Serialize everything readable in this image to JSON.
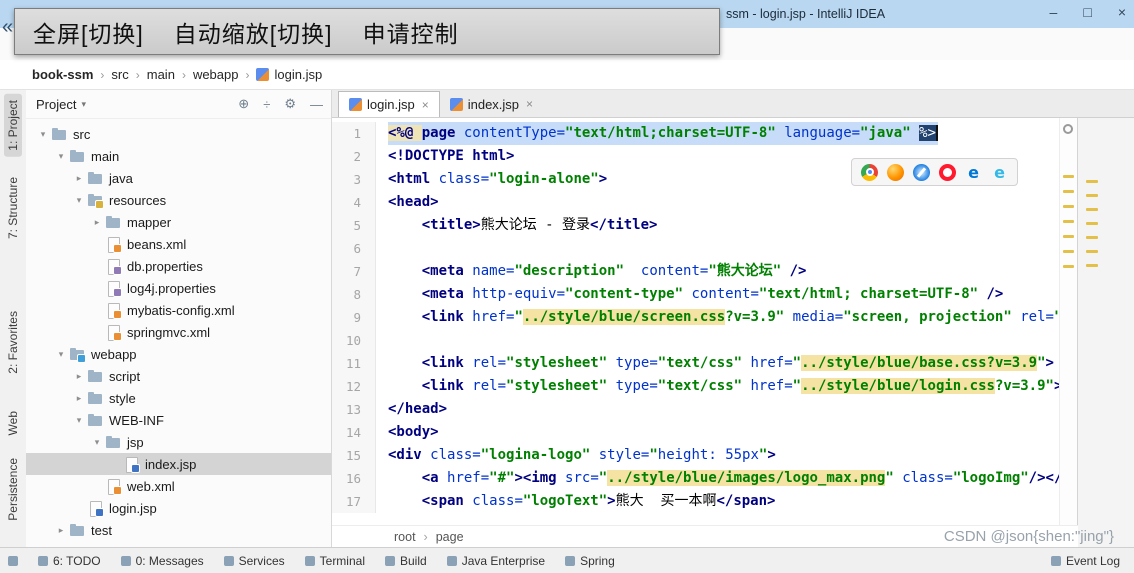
{
  "overlay": {
    "collapse_chevron": "«",
    "buttons": [
      "全屏[切换]",
      "自动缩放[切换]",
      "申请控制"
    ]
  },
  "titlebar": {
    "title": "ssm - login.jsp - IntelliJ IDEA",
    "minimize": "–",
    "maximize": "□",
    "close": "×"
  },
  "breadcrumbs": {
    "items": [
      "book-ssm",
      "src",
      "main",
      "webapp",
      "login.jsp"
    ],
    "separator": "›"
  },
  "tool_stripe": {
    "items": [
      "1: Project",
      "7: Structure",
      "2: Favorites",
      "Web",
      "Persistence"
    ]
  },
  "project_panel": {
    "title": "Project",
    "caret": "▾",
    "header_icons": [
      "⊕",
      "÷",
      "⚙",
      "—"
    ],
    "tree": [
      {
        "label": "src",
        "depth": 0,
        "icon": "folder",
        "expand": "open"
      },
      {
        "label": "main",
        "depth": 1,
        "icon": "folder",
        "expand": "open"
      },
      {
        "label": "java",
        "depth": 2,
        "icon": "folder",
        "expand": "closed"
      },
      {
        "label": "resources",
        "depth": 2,
        "icon": "folder",
        "badge": "res",
        "expand": "open"
      },
      {
        "label": "mapper",
        "depth": 3,
        "icon": "folder",
        "expand": "closed"
      },
      {
        "label": "beans.xml",
        "depth": 3,
        "icon": "file",
        "badge": "xml"
      },
      {
        "label": "db.properties",
        "depth": 3,
        "icon": "file",
        "badge": "props"
      },
      {
        "label": "log4j.properties",
        "depth": 3,
        "icon": "file",
        "badge": "props"
      },
      {
        "label": "mybatis-config.xml",
        "depth": 3,
        "icon": "file",
        "badge": "xml"
      },
      {
        "label": "springmvc.xml",
        "depth": 3,
        "icon": "file",
        "badge": "xml"
      },
      {
        "label": "webapp",
        "depth": 1,
        "icon": "folder",
        "badge": "web",
        "expand": "open"
      },
      {
        "label": "script",
        "depth": 2,
        "icon": "folder",
        "expand": "closed"
      },
      {
        "label": "style",
        "depth": 2,
        "icon": "folder",
        "expand": "closed"
      },
      {
        "label": "WEB-INF",
        "depth": 2,
        "icon": "folder",
        "expand": "open"
      },
      {
        "label": "jsp",
        "depth": 3,
        "icon": "folder",
        "expand": "open"
      },
      {
        "label": "index.jsp",
        "depth": 4,
        "icon": "file",
        "badge": "jsp",
        "selected": true
      },
      {
        "label": "web.xml",
        "depth": 3,
        "icon": "file",
        "badge": "xml"
      },
      {
        "label": "login.jsp",
        "depth": 2,
        "icon": "file",
        "badge": "jsp"
      },
      {
        "label": "test",
        "depth": 1,
        "icon": "folder",
        "expand": "closed"
      }
    ]
  },
  "editor": {
    "tabs": [
      "login.jsp",
      "index.jsp"
    ],
    "close_glyph": "×",
    "breadcrumb": [
      "root",
      "page"
    ],
    "lines": [
      {
        "n": 1,
        "sel": true,
        "tokens": [
          [
            "j",
            "<%@ "
          ],
          [
            "k",
            "page "
          ],
          [
            "a",
            "contentType="
          ],
          [
            "s",
            "\"text/html;charset=UTF-8\""
          ],
          [
            "p",
            " "
          ],
          [
            "a",
            "language="
          ],
          [
            "s",
            "\"java\""
          ],
          [
            "p",
            " "
          ],
          [
            "c",
            "%>"
          ]
        ]
      },
      {
        "n": 2,
        "tokens": [
          [
            "t",
            "<!DOCTYPE html>"
          ]
        ]
      },
      {
        "n": 3,
        "tokens": [
          [
            "t",
            "<html "
          ],
          [
            "a",
            "class="
          ],
          [
            "s",
            "\"login-alone\""
          ],
          [
            "t",
            ">"
          ]
        ]
      },
      {
        "n": 4,
        "tokens": [
          [
            "t",
            "<head>"
          ]
        ]
      },
      {
        "n": 5,
        "tokens": [
          [
            "p",
            "    "
          ],
          [
            "t",
            "<title>"
          ],
          [
            "p",
            "熊大论坛 - 登录"
          ],
          [
            "t",
            "</title>"
          ]
        ]
      },
      {
        "n": 6,
        "tokens": []
      },
      {
        "n": 7,
        "tokens": [
          [
            "p",
            "    "
          ],
          [
            "t",
            "<meta "
          ],
          [
            "a",
            "name="
          ],
          [
            "s",
            "\"description\""
          ],
          [
            "p",
            "  "
          ],
          [
            "a",
            "content="
          ],
          [
            "s",
            "\"熊大论坛\""
          ],
          [
            "p",
            " "
          ],
          [
            "t",
            "/>"
          ]
        ]
      },
      {
        "n": 8,
        "tokens": [
          [
            "p",
            "    "
          ],
          [
            "t",
            "<meta "
          ],
          [
            "a",
            "http-equiv="
          ],
          [
            "s",
            "\"content-type\""
          ],
          [
            "p",
            " "
          ],
          [
            "a",
            "content="
          ],
          [
            "s",
            "\"text/html; charset=UTF-8\""
          ],
          [
            "p",
            " "
          ],
          [
            "t",
            "/>"
          ]
        ]
      },
      {
        "n": 9,
        "tokens": [
          [
            "p",
            "    "
          ],
          [
            "t",
            "<link "
          ],
          [
            "a",
            "href="
          ],
          [
            "s",
            "\""
          ],
          [
            "h",
            "../style/blue/screen.css"
          ],
          [
            "s",
            "?v=3.9\""
          ],
          [
            "p",
            " "
          ],
          [
            "a",
            "media="
          ],
          [
            "s",
            "\"screen, projection\""
          ],
          [
            "p",
            " "
          ],
          [
            "a",
            "rel="
          ],
          [
            "s",
            "\"s"
          ]
        ]
      },
      {
        "n": 10,
        "tokens": []
      },
      {
        "n": 11,
        "tokens": [
          [
            "p",
            "    "
          ],
          [
            "t",
            "<link "
          ],
          [
            "a",
            "rel="
          ],
          [
            "s",
            "\"stylesheet\""
          ],
          [
            "p",
            " "
          ],
          [
            "a",
            "type="
          ],
          [
            "s",
            "\"text/css\""
          ],
          [
            "p",
            " "
          ],
          [
            "a",
            "href="
          ],
          [
            "s",
            "\""
          ],
          [
            "h",
            "../style/blue/base.css?v=3.9"
          ],
          [
            "s",
            "\""
          ],
          [
            "t",
            ">"
          ]
        ]
      },
      {
        "n": 12,
        "tokens": [
          [
            "p",
            "    "
          ],
          [
            "t",
            "<link "
          ],
          [
            "a",
            "rel="
          ],
          [
            "s",
            "\"stylesheet\""
          ],
          [
            "p",
            " "
          ],
          [
            "a",
            "type="
          ],
          [
            "s",
            "\"text/css\""
          ],
          [
            "p",
            " "
          ],
          [
            "a",
            "href="
          ],
          [
            "s",
            "\""
          ],
          [
            "h",
            "../style/blue/login.css"
          ],
          [
            "s",
            "?v=3.9\""
          ],
          [
            "t",
            ">"
          ]
        ]
      },
      {
        "n": 13,
        "tokens": [
          [
            "t",
            "</head>"
          ]
        ]
      },
      {
        "n": 14,
        "tokens": [
          [
            "t",
            "<body>"
          ]
        ]
      },
      {
        "n": 15,
        "tokens": [
          [
            "t",
            "<div "
          ],
          [
            "a",
            "class="
          ],
          [
            "s",
            "\"logina-logo\""
          ],
          [
            "p",
            " "
          ],
          [
            "a",
            "style="
          ],
          [
            "s",
            "\""
          ],
          [
            "y",
            "height: 55px"
          ],
          [
            "s",
            "\""
          ],
          [
            "t",
            ">"
          ]
        ]
      },
      {
        "n": 16,
        "tokens": [
          [
            "p",
            "    "
          ],
          [
            "t",
            "<a "
          ],
          [
            "a",
            "href="
          ],
          [
            "s",
            "\"#\""
          ],
          [
            "t",
            "><img "
          ],
          [
            "a",
            "src="
          ],
          [
            "s",
            "\""
          ],
          [
            "h",
            "../style/blue/images/logo_max.png"
          ],
          [
            "s",
            "\""
          ],
          [
            "p",
            " "
          ],
          [
            "a",
            "class="
          ],
          [
            "s",
            "\"logoImg\""
          ],
          [
            "t",
            "/></a"
          ]
        ]
      },
      {
        "n": 17,
        "tokens": [
          [
            "p",
            "    "
          ],
          [
            "t",
            "<span "
          ],
          [
            "a",
            "class="
          ],
          [
            "s",
            "\"logoText\""
          ],
          [
            "t",
            ">"
          ],
          [
            "p",
            "熊大  买一本啊"
          ],
          [
            "t",
            "</span>"
          ]
        ]
      }
    ]
  },
  "browser_bar": {
    "browsers": [
      "chrome",
      "firefox",
      "safari",
      "opera",
      "edge",
      "ie"
    ]
  },
  "status_bar": {
    "items": [
      "6: TODO",
      "0: Messages",
      "Services",
      "Terminal",
      "Build",
      "Java Enterprise",
      "Spring"
    ],
    "right": "Event Log"
  },
  "watermark": "CSDN @json{shen:\"jing\"}"
}
